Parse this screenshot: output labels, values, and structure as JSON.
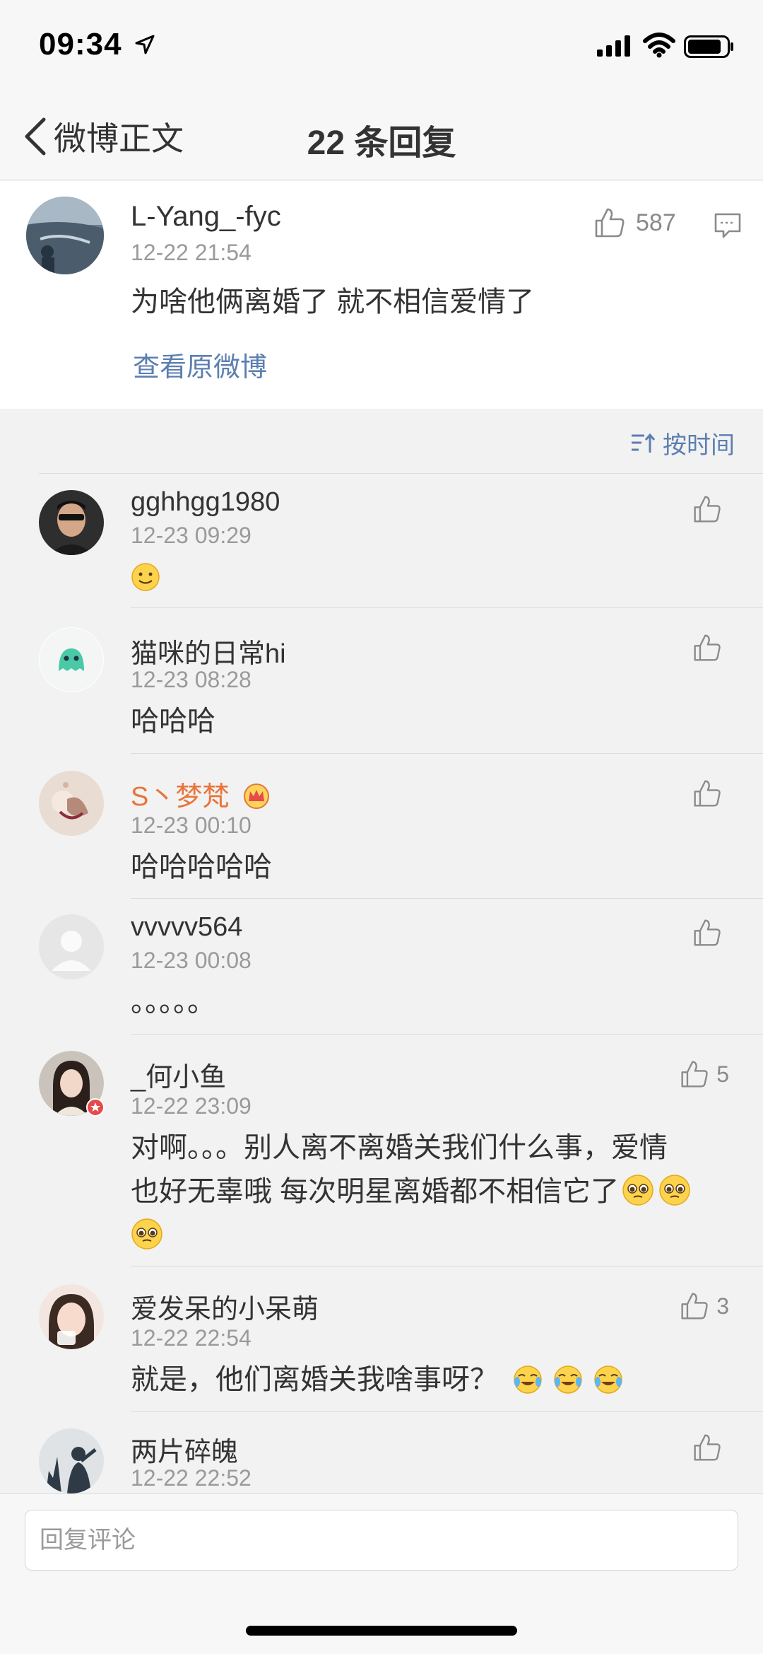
{
  "status": {
    "time": "09:34"
  },
  "nav": {
    "back_label": "微博正文",
    "title": "22 条回复"
  },
  "top_comment": {
    "username": "L-Yang_-fyc",
    "time": "12-22 21:54",
    "likes": "587",
    "content": "为啥他俩离婚了 就不相信爱情了",
    "view_original": "查看原微博"
  },
  "sort": {
    "label": "按时间"
  },
  "comments": [
    {
      "username": "gghhgg1980",
      "time": "12-23 09:29",
      "content": "",
      "likes": ""
    },
    {
      "username": "猫咪的日常hi",
      "time": "12-23 08:28",
      "content": "哈哈哈",
      "likes": ""
    },
    {
      "username": "S丶梦梵",
      "time": "12-23 00:10",
      "content": "哈哈哈哈哈",
      "likes": ""
    },
    {
      "username": "vvvvv564",
      "time": "12-23 00:08",
      "content": "。。。。。",
      "likes": ""
    },
    {
      "username": "_何小鱼",
      "time": "12-22 23:09",
      "content_line1": "对啊。。。别人离不离婚关我们什么事，爱情",
      "content_line2": "也好无辜哦 每次明星离婚都不相信它了",
      "likes": "5"
    },
    {
      "username": "爱发呆的小呆萌",
      "time": "12-22 22:54",
      "content": "就是，他们离婚关我啥事呀？",
      "likes": "3"
    },
    {
      "username": "两片碎魄",
      "time": "12-22 22:52",
      "content": "",
      "likes": ""
    }
  ],
  "input": {
    "placeholder": "回复评论"
  },
  "colors": {
    "link": "#5b7fb0",
    "vip_name": "#e8743b",
    "meta": "#9a9a9a"
  }
}
